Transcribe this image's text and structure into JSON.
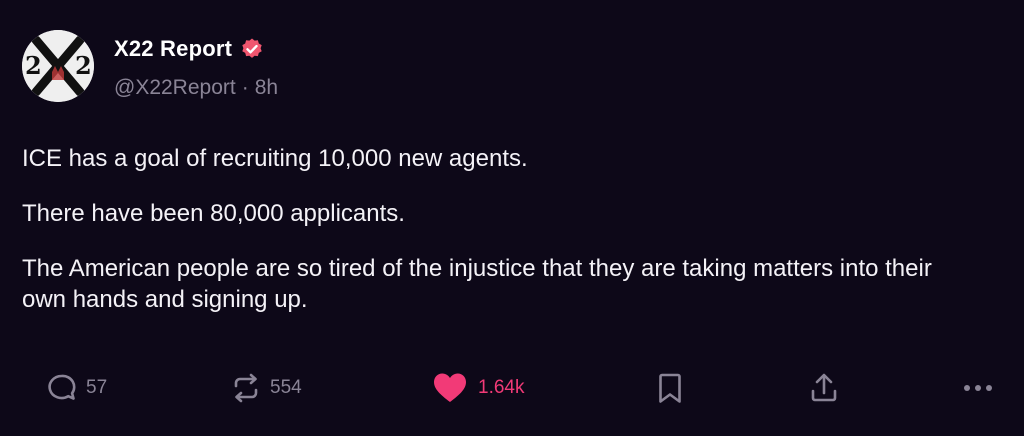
{
  "author": {
    "display_name": "X22 Report",
    "handle": "@X22Report",
    "separator": "·",
    "time": "8h",
    "verified_icon": "verified-badge-icon",
    "verified_color": "#f0566f",
    "avatar_text": "X22"
  },
  "post": {
    "paragraphs": [
      "ICE has a goal of recruiting 10,000 new agents.",
      "There have been 80,000 applicants.",
      "The American people are so tired of the injustice that they are taking matters into their own hands and signing up."
    ]
  },
  "actions": {
    "reply": {
      "icon": "reply-icon",
      "count": "57"
    },
    "repost": {
      "icon": "repost-icon",
      "count": "554"
    },
    "like": {
      "icon": "heart-icon",
      "count": "1.64k",
      "liked": true,
      "color": "#f23a77"
    },
    "bookmark": {
      "icon": "bookmark-icon"
    },
    "share": {
      "icon": "share-icon"
    },
    "more": {
      "icon": "more-icon"
    }
  },
  "colors": {
    "background": "#0d0818",
    "text": "#f4f2f7",
    "muted": "#8a8496",
    "accent": "#f23a77"
  }
}
